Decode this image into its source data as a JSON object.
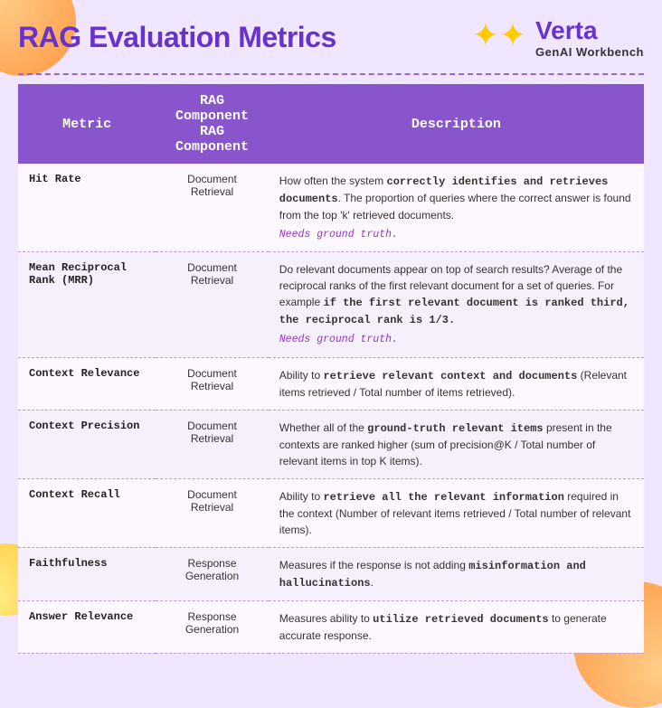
{
  "header": {
    "title": "RAG Evaluation Metrics",
    "brand_name": "Verta",
    "brand_sub": "GenAI Workbench"
  },
  "table": {
    "columns": [
      "Metric",
      "RAG Component",
      "Description"
    ],
    "rows": [
      {
        "metric": "Hit Rate",
        "rag_component": "Document Retrieval",
        "description_html": "How often the system <strong>correctly identifies and retrieves documents</strong>. The proportion of queries where the correct answer is found from the top 'k' retrieved documents.",
        "ground_truth": "Needs ground truth."
      },
      {
        "metric": "Mean Reciprocal Rank (MRR)",
        "rag_component": "Document Retrieval",
        "description_html": "Do relevant documents appear on top of search results? Average of the reciprocal ranks of the first relevant document for a set of queries. For example <strong>if the first relevant document is ranked third, the reciprocal rank is 1/3.</strong>",
        "ground_truth": "Needs ground truth."
      },
      {
        "metric": "Context Relevance",
        "rag_component": "Document Retrieval",
        "description_html": "Ability to <strong>retrieve relevant context and documents</strong> (Relevant items retrieved / Total number of items retrieved).",
        "ground_truth": ""
      },
      {
        "metric": "Context Precision",
        "rag_component": "Document Retrieval",
        "description_html": "Whether all of the <strong>ground-truth relevant items</strong> present in the contexts are ranked higher (sum of precision@K / Total number of relevant items in top K items).",
        "ground_truth": ""
      },
      {
        "metric": "Context Recall",
        "rag_component": "Document Retrieval",
        "description_html": "Ability to <strong>retrieve all the relevant information</strong> required in the context (Number of relevant items retrieved / Total number of relevant items).",
        "ground_truth": ""
      },
      {
        "metric": "Faithfulness",
        "rag_component": "Response Generation",
        "description_html": "Measures if the response is not adding <strong>misinformation and hallucinations</strong>.",
        "ground_truth": ""
      },
      {
        "metric": "Answer Relevance",
        "rag_component": "Response Generation",
        "description_html": "Measures ability to <strong>utilize retrieved documents</strong> to generate accurate response.",
        "ground_truth": ""
      }
    ]
  }
}
